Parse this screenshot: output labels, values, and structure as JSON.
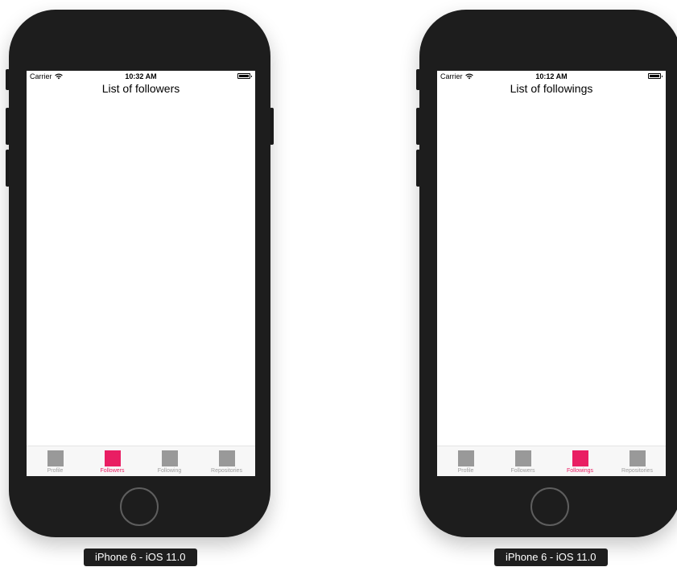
{
  "devices": [
    {
      "label": "iPhone 6 - iOS 11.0",
      "status": {
        "carrier": "Carrier",
        "time": "10:32 AM"
      },
      "title": "List of followers",
      "tabs": [
        {
          "label": "Profile",
          "active": false
        },
        {
          "label": "Followers",
          "active": true
        },
        {
          "label": "Following",
          "active": false
        },
        {
          "label": "Repositories",
          "active": false
        }
      ]
    },
    {
      "label": "iPhone 6 - iOS 11.0",
      "status": {
        "carrier": "Carrier",
        "time": "10:12 AM"
      },
      "title": "List of followings",
      "tabs": [
        {
          "label": "Profile",
          "active": false
        },
        {
          "label": "Followers",
          "active": false
        },
        {
          "label": "Followings",
          "active": true
        },
        {
          "label": "Repositories",
          "active": false
        }
      ]
    }
  ],
  "colors": {
    "accent": "#e91e63",
    "tab_inactive_icon": "#999999",
    "device_body": "#1d1d1d"
  }
}
